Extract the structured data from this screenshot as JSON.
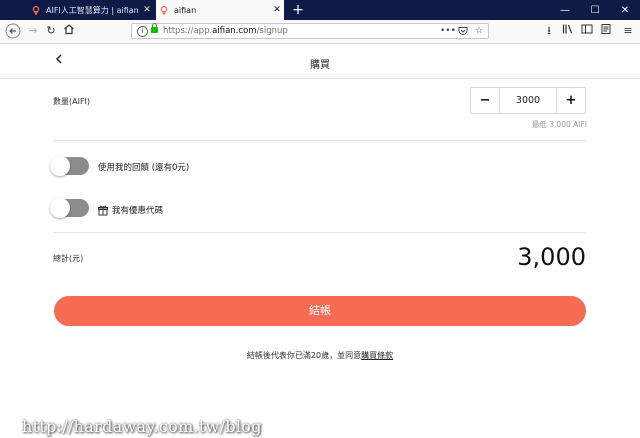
{
  "browser": {
    "tabs": [
      {
        "label": "AIFI人工智慧算力 | aifian",
        "active": false
      },
      {
        "label": "aifian",
        "active": true
      }
    ],
    "url_host": "https://app.",
    "url_domain": "aifian.com",
    "url_path": "/signup",
    "tab_icon": "aifian-logo-icon",
    "accent": "#0f1b47",
    "secure_color": "#12bc00"
  },
  "page": {
    "title": "購買",
    "quantity_label": "數量(AIFI)",
    "quantity_value": "3000",
    "min_note": "最低 3,000 AIFI",
    "use_rewards_label": "使用我的回饋 (還有0元)",
    "coupon_label": "我有優惠代碼",
    "total_label": "總計(元)",
    "total_amount": "3,000",
    "checkout_label": "結帳",
    "checkout_color": "#f66b53",
    "terms_text": "結帳後代表你已滿20歲，並同意",
    "terms_link": "購買條款"
  },
  "watermark": "http://hardaway.com.tw/blog"
}
